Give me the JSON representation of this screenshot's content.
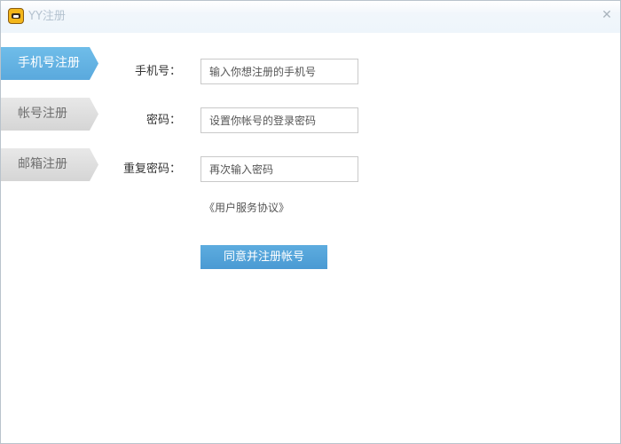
{
  "window": {
    "title": "YY注册",
    "close_glyph": "✕",
    "app_icon": "yy-logo-icon"
  },
  "sidebar": {
    "tabs": [
      {
        "label": "手机号注册",
        "active": true
      },
      {
        "label": "帐号注册",
        "active": false
      },
      {
        "label": "邮箱注册",
        "active": false
      }
    ]
  },
  "form": {
    "phone": {
      "label": "手机号：",
      "placeholder": "输入你想注册的手机号",
      "value": ""
    },
    "password": {
      "label": "密码：",
      "placeholder": "设置你帐号的登录密码",
      "value": ""
    },
    "confirm_password": {
      "label": "重复密码：",
      "placeholder": "再次输入密码",
      "value": ""
    },
    "agreement_link": "《用户服务协议》",
    "submit_label": "同意并注册帐号"
  },
  "colors": {
    "accent": "#5aa9dd",
    "button": "#4a9ad3",
    "inactive_tab": "#d5d5d5"
  }
}
